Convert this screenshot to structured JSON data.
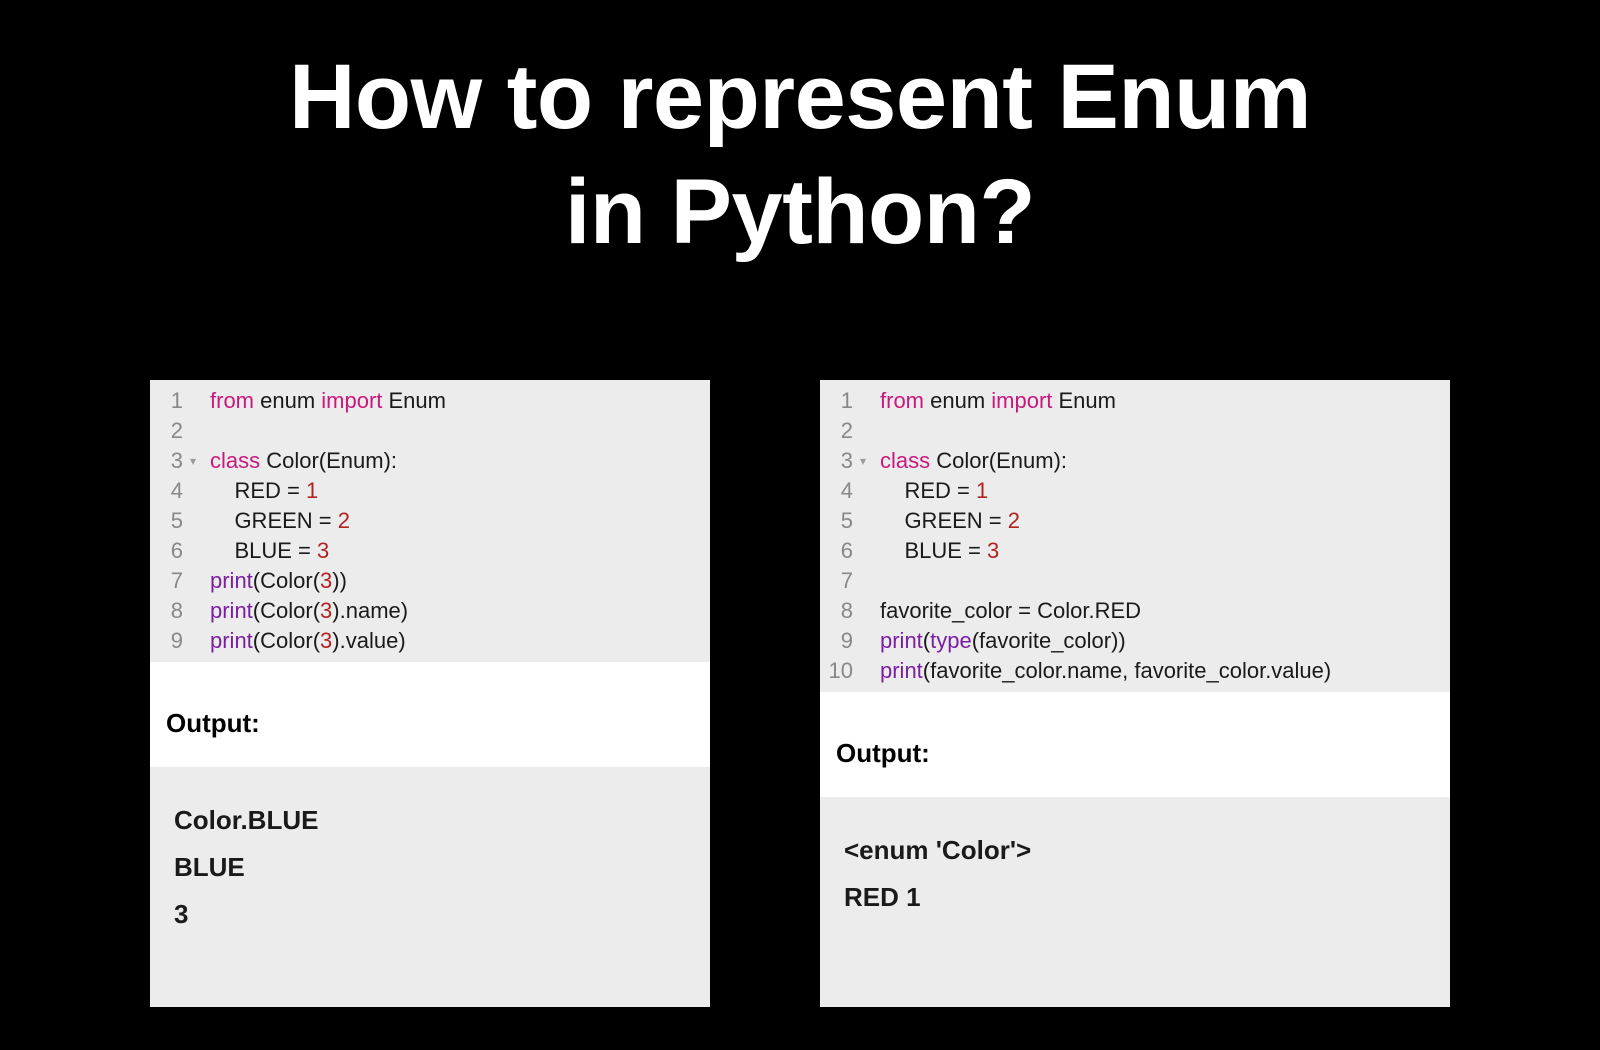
{
  "title_line1": "How to represent Enum",
  "title_line2": "in Python?",
  "left": {
    "gutter": [
      "1",
      "2",
      "3",
      "4",
      "5",
      "6",
      "7",
      "8",
      "9"
    ],
    "fold_index": 2,
    "code": {
      "l1_from": "from",
      "l1_mod": " enum ",
      "l1_import": "import",
      "l1_name": " Enum",
      "l2": "",
      "l3_class": "class",
      "l3_rest": " Color(Enum):",
      "l4_pre": "    RED = ",
      "l4_num": "1",
      "l5_pre": "    GREEN = ",
      "l5_num": "2",
      "l6_pre": "    BLUE = ",
      "l6_num": "3",
      "l7_print": "print",
      "l7_open": "(Color(",
      "l7_num": "3",
      "l7_close": "))",
      "l8_print": "print",
      "l8_open": "(Color(",
      "l8_num": "3",
      "l8_close": ").name)",
      "l9_print": "print",
      "l9_open": "(Color(",
      "l9_num": "3",
      "l9_close": ").value)"
    },
    "output_label": "Output:",
    "output": {
      "o1": "Color.BLUE",
      "o2": "BLUE",
      "o3": "3"
    }
  },
  "right": {
    "gutter": [
      "1",
      "2",
      "3",
      "4",
      "5",
      "6",
      "7",
      "8",
      "9",
      "10"
    ],
    "fold_index": 2,
    "code": {
      "l1_from": "from",
      "l1_mod": " enum ",
      "l1_import": "import",
      "l1_name": " Enum",
      "l2": "",
      "l3_class": "class",
      "l3_rest": " Color(Enum):",
      "l4_pre": "    RED = ",
      "l4_num": "1",
      "l5_pre": "    GREEN = ",
      "l5_num": "2",
      "l6_pre": "    BLUE = ",
      "l6_num": "3",
      "l7": "",
      "l8": "favorite_color = Color.RED",
      "l9_print": "print",
      "l9_open": "(",
      "l9_type": "type",
      "l9_close": "(favorite_color))",
      "l10_print": "print",
      "l10_rest": "(favorite_color.name, favorite_color.value)"
    },
    "output_label": "Output:",
    "output": {
      "o1": "<enum 'Color'>",
      "o2": "RED 1"
    }
  }
}
